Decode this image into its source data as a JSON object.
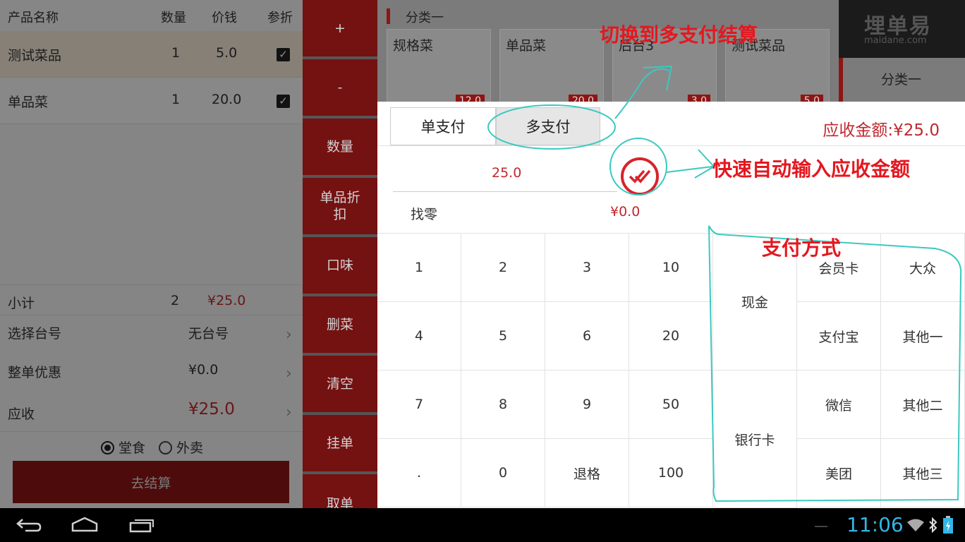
{
  "order": {
    "headers": {
      "name": "产品名称",
      "qty": "数量",
      "price": "价钱",
      "discount": "参折"
    },
    "items": [
      {
        "name": "测试菜品",
        "qty": "1",
        "price": "5.0",
        "checked": true
      },
      {
        "name": "单品菜",
        "qty": "1",
        "price": "20.0",
        "checked": true
      }
    ],
    "subtotal": {
      "label": "小计",
      "qty": "2",
      "amount": "¥25.0"
    },
    "table": {
      "label": "选择台号",
      "value": "无台号"
    },
    "discount": {
      "label": "整单优惠",
      "value": "¥0.0"
    },
    "receivable": {
      "label": "应收",
      "value": "¥25.0"
    },
    "dine_in": "堂食",
    "takeout": "外卖",
    "checkout_button": "去结算"
  },
  "actions": [
    "+",
    "-",
    "数量",
    "单品折扣",
    "口味",
    "删菜",
    "清空",
    "挂单",
    "取单"
  ],
  "catalog": {
    "category_title": "分类一",
    "cards": [
      {
        "name": "规格菜",
        "price": "12.0"
      },
      {
        "name": "单品菜",
        "price": "20.0"
      },
      {
        "name": "后台3",
        "price": "3.0"
      },
      {
        "name": "测试菜品",
        "price": "5.0"
      }
    ],
    "right_category": "分类一"
  },
  "brand": {
    "name": "埋单易",
    "url": "maidane.com"
  },
  "payment": {
    "single_tab": "单支付",
    "multi_tab": "多支付",
    "due_label": "应收金额:¥25.0",
    "input_value": "25.0",
    "change_label": "找零",
    "change_value": "¥0.0",
    "keypad": [
      "1",
      "2",
      "3",
      "10",
      "4",
      "5",
      "6",
      "20",
      "7",
      "8",
      "9",
      "50",
      ".",
      "0",
      "退格",
      "100"
    ],
    "methods": {
      "cash": "现金",
      "bankcard": "银行卡",
      "member": "会员卡",
      "dazhong": "大众",
      "alipay": "支付宝",
      "other1": "其他一",
      "wechat": "微信",
      "other2": "其他二",
      "meituan": "美团",
      "other3": "其他三"
    }
  },
  "annotations": {
    "switch": "切换到多支付结算",
    "auto_fill": "快速自动输入应收金额",
    "methods": "支付方式"
  },
  "system": {
    "time": "11:06"
  },
  "colors": {
    "accent_red": "#8e1515",
    "text_red": "#c0282f",
    "annotation_red": "#e4171f",
    "annotation_teal": "#3cc8c0"
  }
}
